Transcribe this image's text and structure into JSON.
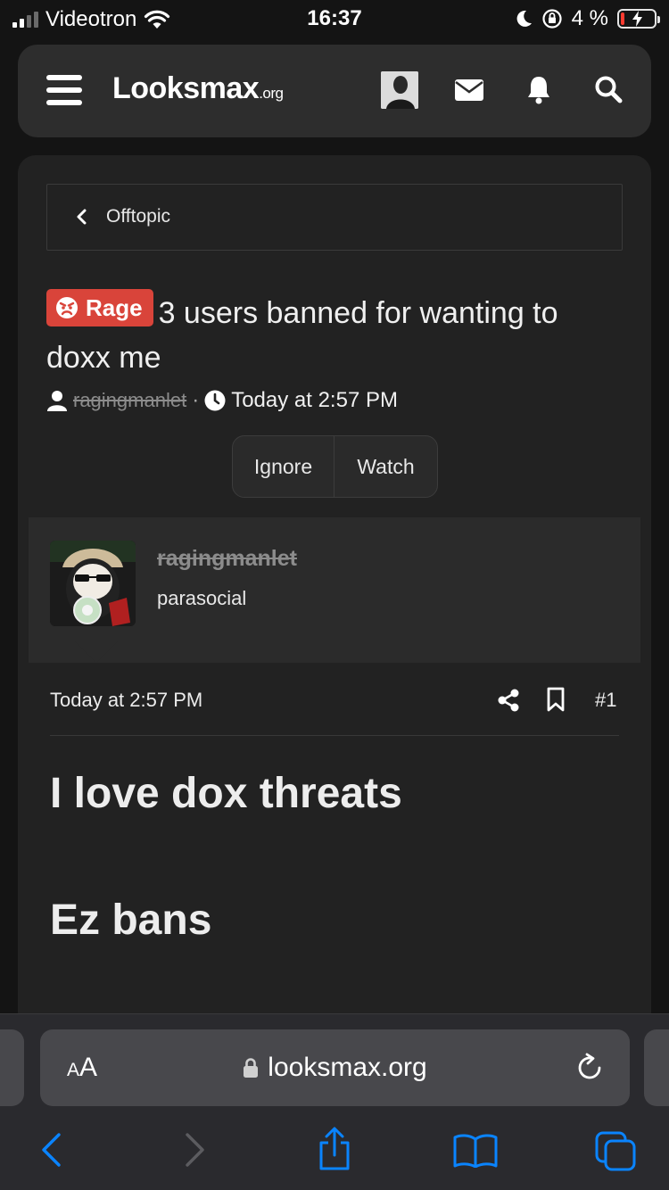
{
  "status_bar": {
    "carrier": "Videotron",
    "time": "16:37",
    "battery_percent": "4 %"
  },
  "site_header": {
    "logo_main": "Lᴏᴏksmax",
    "logo_suffix": ".org",
    "icons": [
      "menu-icon",
      "avatar",
      "envelope-icon",
      "bell-icon",
      "search-icon"
    ]
  },
  "breadcrumb": {
    "label": "Offtopic"
  },
  "thread": {
    "prefix_label": "Rage",
    "title": "3 users banned for wanting to doxx me",
    "author": "ragingmanlet",
    "separator": "·",
    "date": "Today at 2:57 PM",
    "buttons": {
      "ignore": "Ignore",
      "watch": "Watch"
    }
  },
  "post": {
    "user_name": "ragingmanlet",
    "user_title": "parasocial",
    "date": "Today at 2:57 PM",
    "number": "#1",
    "body_lines": [
      "I love dox threats",
      "Ez bans"
    ]
  },
  "safari": {
    "aa_large": "A",
    "aa_small": "A",
    "url": "looksmax.org"
  },
  "colors": {
    "rage_badge": "#d9443a",
    "safari_blue": "#0a84ff"
  }
}
